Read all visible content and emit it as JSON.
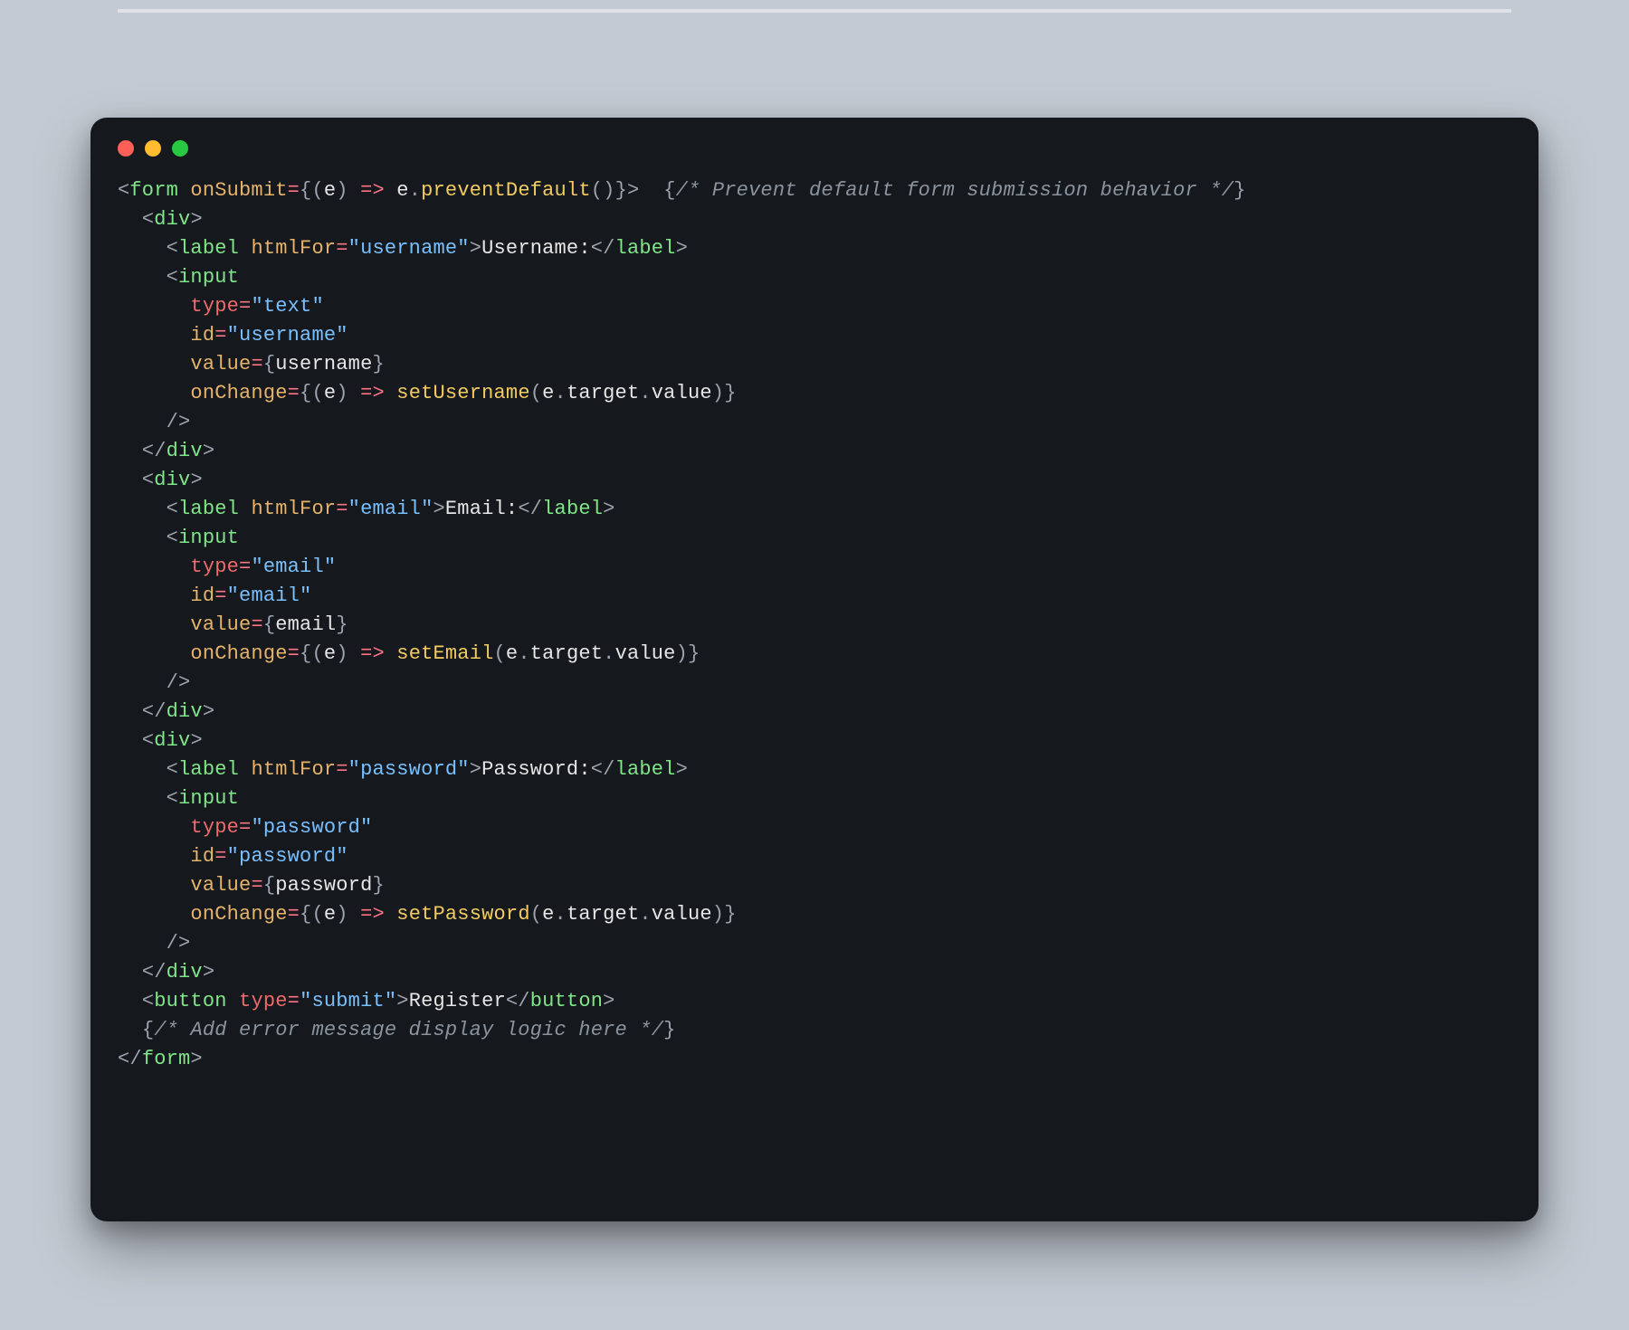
{
  "code": {
    "line1": "<form onSubmit={(e) => e.preventDefault()}>  {/* Prevent default form submission behavior */}",
    "line2": "  <div>",
    "line3": "    <label htmlFor=\"username\">Username:</label>",
    "line4": "    <input",
    "line5": "      type=\"text\"",
    "line6": "      id=\"username\"",
    "line7": "      value={username}",
    "line8": "      onChange={(e) => setUsername(e.target.value)}",
    "line9": "    />",
    "line10": "  </div>",
    "line11": "  <div>",
    "line12": "    <label htmlFor=\"email\">Email:</label>",
    "line13": "    <input",
    "line14": "      type=\"email\"",
    "line15": "      id=\"email\"",
    "line16": "      value={email}",
    "line17": "      onChange={(e) => setEmail(e.target.value)}",
    "line18": "    />",
    "line19": "  </div>",
    "line20": "  <div>",
    "line21": "    <label htmlFor=\"password\">Password:</label>",
    "line22": "    <input",
    "line23": "      type=\"password\"",
    "line24": "      id=\"password\"",
    "line25": "      value={password}",
    "line26": "      onChange={(e) => setPassword(e.target.value)}",
    "line27": "    />",
    "line28": "  </div>",
    "line29": "  <button type=\"submit\">Register</button>",
    "line30": "  {/* Add error message display logic here */}",
    "line31": "</form>",
    "labels": {
      "username": "Username:",
      "email": "Email:",
      "password": "Password:"
    },
    "fields": [
      {
        "id": "username",
        "type": "text",
        "state": "username",
        "setter": "setUsername"
      },
      {
        "id": "email",
        "type": "email",
        "state": "email",
        "setter": "setEmail"
      },
      {
        "id": "password",
        "type": "password",
        "state": "password",
        "setter": "setPassword"
      }
    ],
    "button": {
      "type": "submit",
      "text": "Register"
    },
    "comments": {
      "top": "Prevent default form submission behavior",
      "bottom": "Add error message display logic here"
    }
  },
  "traffic": {
    "red": "#ff5f57",
    "yellow": "#febc2e",
    "green": "#28c840"
  }
}
